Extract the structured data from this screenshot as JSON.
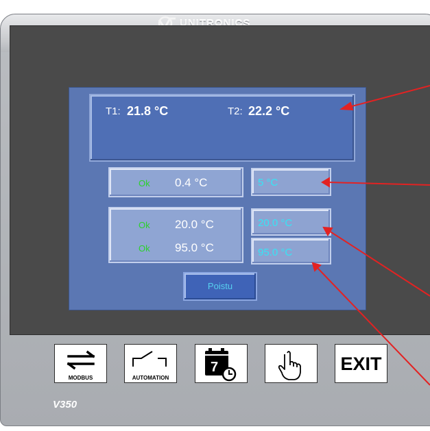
{
  "brand": {
    "name": "UNITRONICS"
  },
  "model": "V350",
  "screen": {
    "t1_label": "T1:",
    "t1_value": "21.8 °C",
    "t2_label": "T2:",
    "t2_value": "22.2 °C",
    "rows": [
      {
        "status": "Ok",
        "value": "0.4 °C",
        "setpoint": "5 °C"
      },
      {
        "status": "Ok",
        "value": "20.0 °C",
        "setpoint": "20.0 °C"
      },
      {
        "status": "Ok",
        "value": "95.0 °C",
        "setpoint": "95.0 °C"
      }
    ],
    "exit_button": "Poistu"
  },
  "soft_keys": [
    {
      "caption": "MODBUS",
      "icon": "exchange-arrows-icon"
    },
    {
      "caption": "AUTOMATION",
      "icon": "switch-icon"
    },
    {
      "caption": "",
      "icon": "calendar-clock-icon",
      "day": "7"
    },
    {
      "caption": "",
      "icon": "hand-pointer-icon"
    },
    {
      "caption": "EXIT",
      "icon": ""
    }
  ],
  "colors": {
    "screen_background": "#5b77b3",
    "status_ok": "#2bd12b",
    "setpoint_text": "#35e5f5",
    "annotation_arrow": "#e32222"
  }
}
